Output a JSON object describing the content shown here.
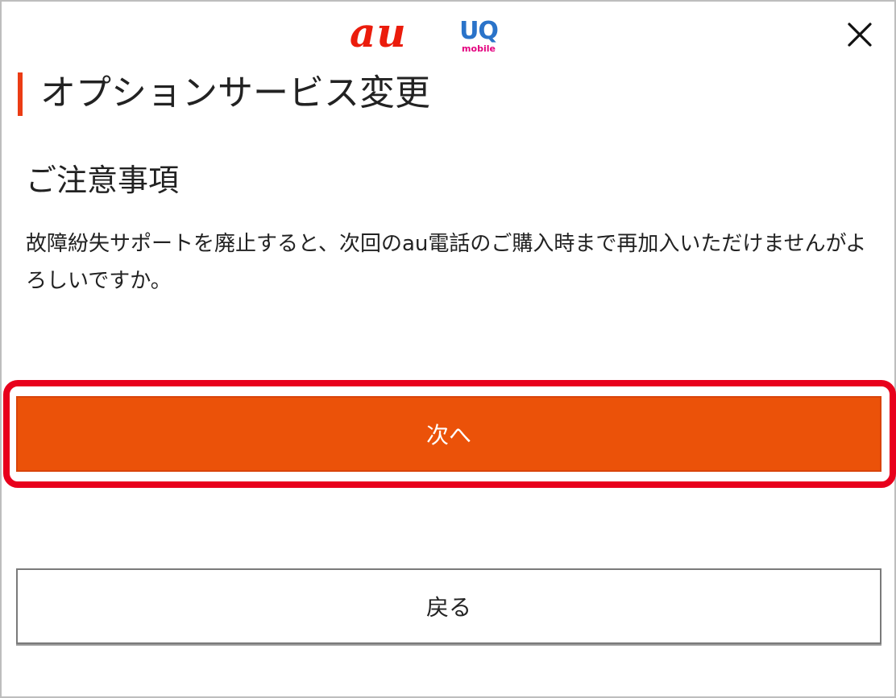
{
  "header": {
    "logo_au": "au",
    "logo_uq_main": "UQ",
    "logo_uq_sub": "mobile",
    "close_icon": "close-icon"
  },
  "page": {
    "title": "オプションサービス変更"
  },
  "notice": {
    "heading": "ご注意事項",
    "text": "故障紛失サポートを廃止すると、次回のau電話のご購入時まで再加入いただけませんがよろしいですか。"
  },
  "buttons": {
    "next_label": "次へ",
    "back_label": "戻る"
  },
  "colors": {
    "brand_orange": "#eb5209",
    "highlight_red": "#e8001c",
    "au_red": "#eb1c0c",
    "uq_blue": "#2a73c9"
  }
}
